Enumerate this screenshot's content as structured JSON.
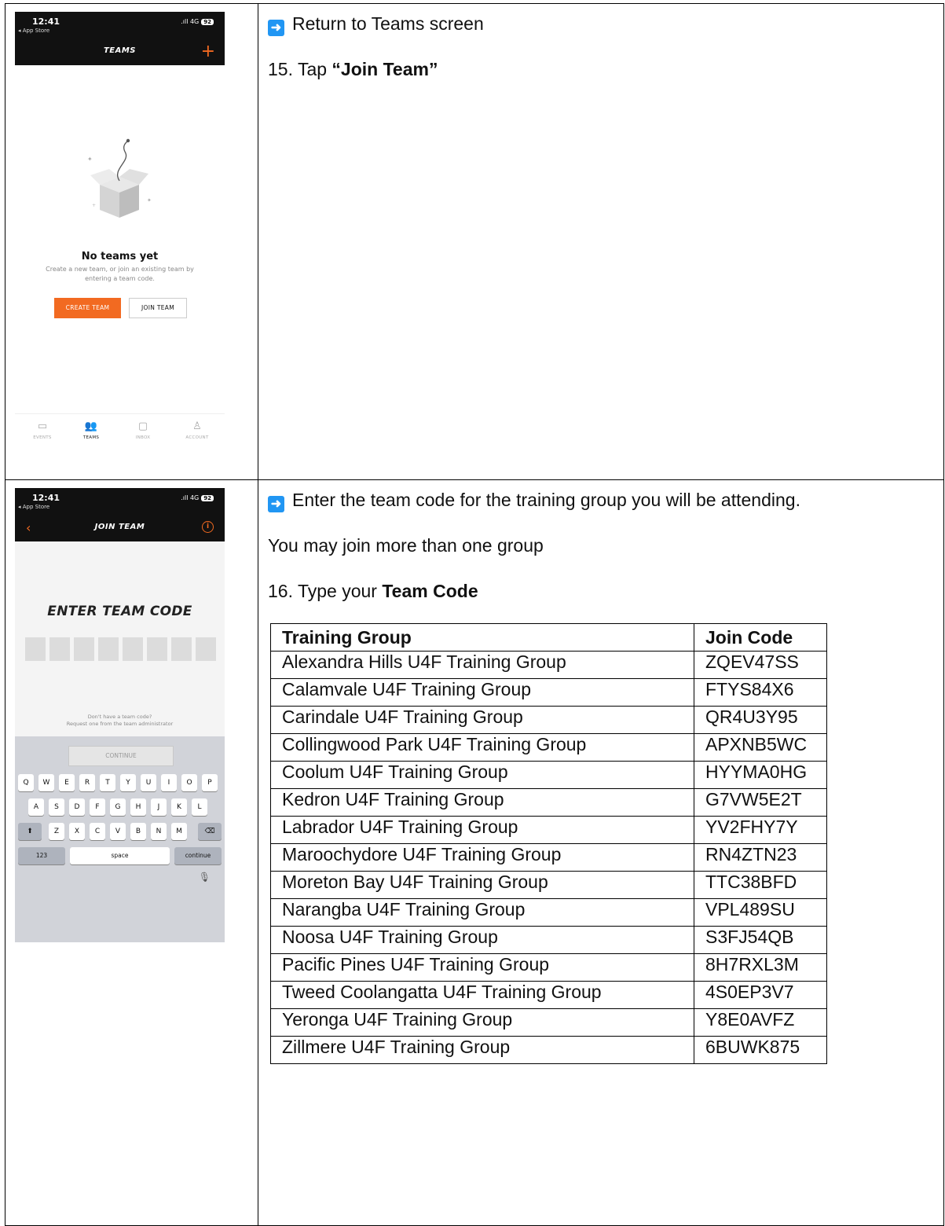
{
  "step15": {
    "instruction": "Return to Teams screen",
    "step_number": "15. Tap",
    "step_bold": "“Join Team”"
  },
  "step16": {
    "instruction": "Enter the team code for the training group you will be attending.",
    "note": "You may join more than one group",
    "step_number": "16. Type your",
    "step_bold": "Team Code"
  },
  "phone_common": {
    "time": "12:41",
    "back_label": "◂ App Store",
    "network": ".ıll 4G",
    "battery": "92"
  },
  "teams_screen": {
    "title": "TEAMS",
    "empty_title": "No teams yet",
    "empty_desc": "Create a new team, or join an existing team by entering a team code.",
    "create_button": "CREATE TEAM",
    "join_button": "JOIN TEAM",
    "tabs": [
      {
        "label": "EVENTS",
        "icon": "calendar-icon"
      },
      {
        "label": "TEAMS",
        "icon": "people-icon"
      },
      {
        "label": "INBOX",
        "icon": "chat-icon"
      },
      {
        "label": "ACCOUNT",
        "icon": "person-icon"
      }
    ]
  },
  "join_screen": {
    "title": "JOIN TEAM",
    "heading": "ENTER TEAM CODE",
    "no_code_line1": "Don't have a team code?",
    "no_code_line2": "Request one from the team administrator",
    "continue_button": "CONTINUE",
    "keyboard_row1": [
      "Q",
      "W",
      "E",
      "R",
      "T",
      "Y",
      "U",
      "I",
      "O",
      "P"
    ],
    "keyboard_row2": [
      "A",
      "S",
      "D",
      "F",
      "G",
      "H",
      "J",
      "K",
      "L"
    ],
    "keyboard_row3": [
      "Z",
      "X",
      "C",
      "V",
      "B",
      "N",
      "M"
    ],
    "key_123": "123",
    "key_space": "space",
    "key_continue": "continue"
  },
  "codes_table": {
    "headers": [
      "Training Group",
      "Join Code"
    ],
    "rows": [
      [
        "Alexandra Hills U4F Training Group",
        "ZQEV47SS"
      ],
      [
        "Calamvale U4F Training Group",
        "FTYS84X6"
      ],
      [
        "Carindale U4F Training Group",
        "QR4U3Y95"
      ],
      [
        "Collingwood Park U4F Training Group",
        "APXNB5WC"
      ],
      [
        "Coolum U4F Training Group",
        "HYYMA0HG"
      ],
      [
        "Kedron U4F Training Group",
        "G7VW5E2T"
      ],
      [
        "Labrador U4F Training Group",
        "YV2FHY7Y"
      ],
      [
        "Maroochydore U4F Training Group",
        "RN4ZTN23"
      ],
      [
        "Moreton Bay U4F Training Group",
        "TTC38BFD"
      ],
      [
        "Narangba U4F Training Group",
        "VPL489SU"
      ],
      [
        "Noosa U4F Training Group",
        "S3FJ54QB"
      ],
      [
        "Pacific Pines U4F Training Group",
        "8H7RXL3M"
      ],
      [
        "Tweed Coolangatta U4F Training Group",
        "4S0EP3V7"
      ],
      [
        "Yeronga U4F Training Group",
        "Y8E0AVFZ"
      ],
      [
        "Zillmere U4F Training Group",
        "6BUWK875"
      ]
    ]
  },
  "colors": {
    "accent_orange": "#f26a21",
    "arrow_blue": "#2196f3"
  }
}
